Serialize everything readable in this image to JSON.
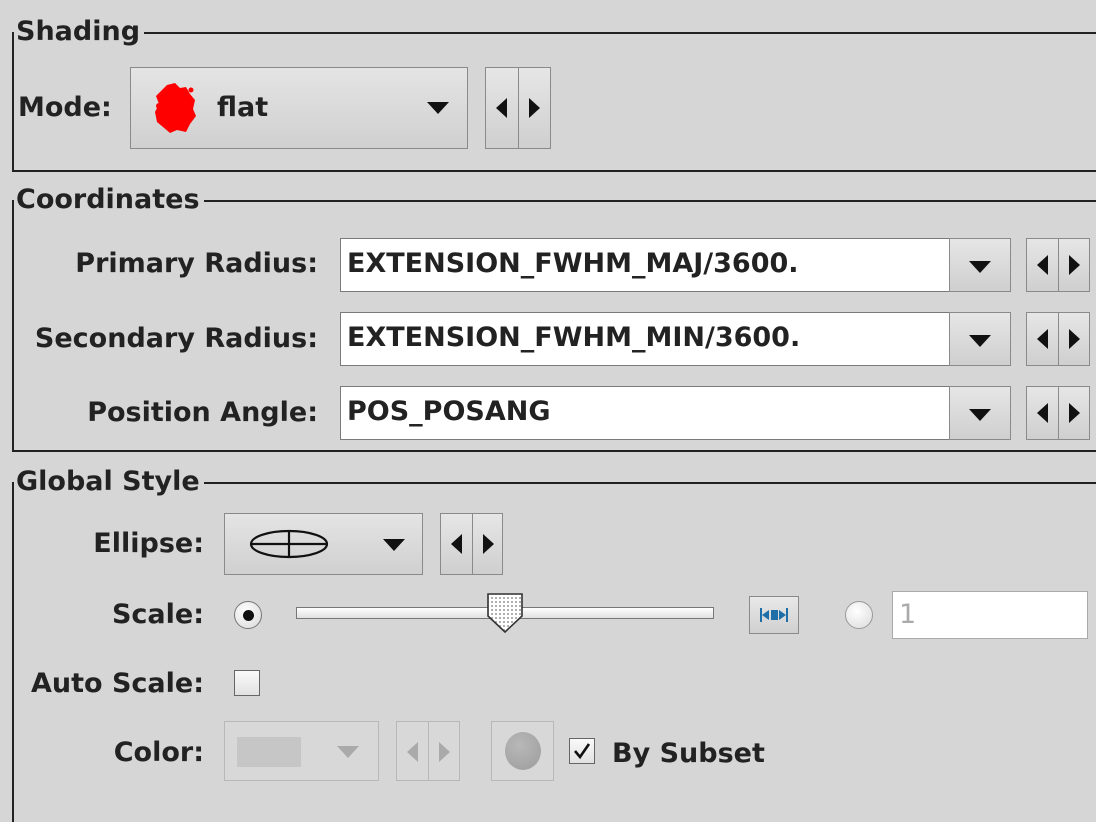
{
  "shading": {
    "title": "Shading",
    "mode_label": "Mode:",
    "mode_value": "flat",
    "mode_icon": "red-blob-icon",
    "mode_icon_color": "#ff0000"
  },
  "coordinates": {
    "title": "Coordinates",
    "rows": [
      {
        "label": "Primary Radius:",
        "value": "EXTENSION_FWHM_MAJ/3600."
      },
      {
        "label": "Secondary Radius:",
        "value": "EXTENSION_FWHM_MIN/3600."
      },
      {
        "label": "Position Angle:",
        "value": "POS_POSANG"
      }
    ]
  },
  "global_style": {
    "title": "Global Style",
    "ellipse_label": "Ellipse:",
    "ellipse_icon": "ellipse-crosshair-icon",
    "scale_label": "Scale:",
    "scale_slider_fraction": 0.5,
    "scale_value_placeholder": "1",
    "auto_scale_label": "Auto Scale:",
    "auto_scale_checked": false,
    "color_label": "Color:",
    "by_subset_label": "By Subset",
    "by_subset_checked": true
  },
  "colors": {
    "background": "#d6d6d6",
    "accent_blue": "#1e6fa8"
  }
}
